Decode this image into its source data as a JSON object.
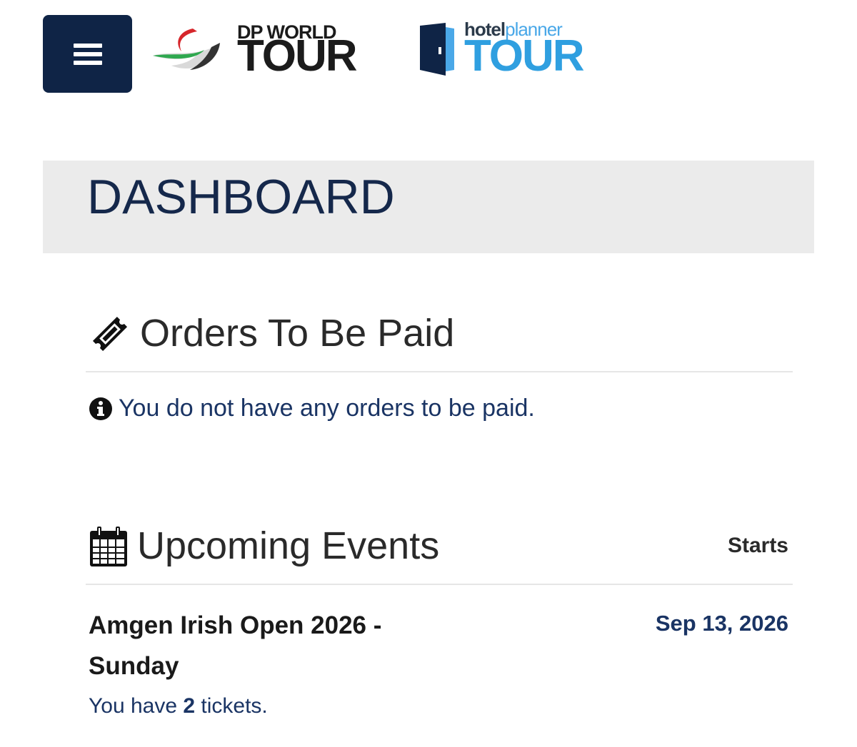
{
  "header": {
    "menu_icon": "hamburger-menu-icon",
    "logo_dp": {
      "small": "DP WORLD",
      "big": "TOUR"
    },
    "logo_hp": {
      "small_bold": "hotel",
      "small_light": "planner",
      "big": "TOUR"
    }
  },
  "dashboard": {
    "title": "DASHBOARD"
  },
  "orders": {
    "title": "Orders To Be Paid",
    "icon": "ticket-icon",
    "message_icon": "info-circle-icon",
    "message": "You do not have any orders to be paid."
  },
  "events": {
    "title": "Upcoming Events",
    "icon": "calendar-icon",
    "starts_label": "Starts",
    "items": [
      {
        "name": "Amgen Irish Open 2026 - Sunday",
        "date": "Sep 13, 2026",
        "tickets_prefix": "You have ",
        "tickets_count": "2",
        "tickets_suffix": " tickets."
      }
    ]
  },
  "colors": {
    "navy": "#0f2446",
    "text_blue": "#1a3464",
    "band_gray": "#ebebeb",
    "hp_blue": "#2f9fe0"
  }
}
